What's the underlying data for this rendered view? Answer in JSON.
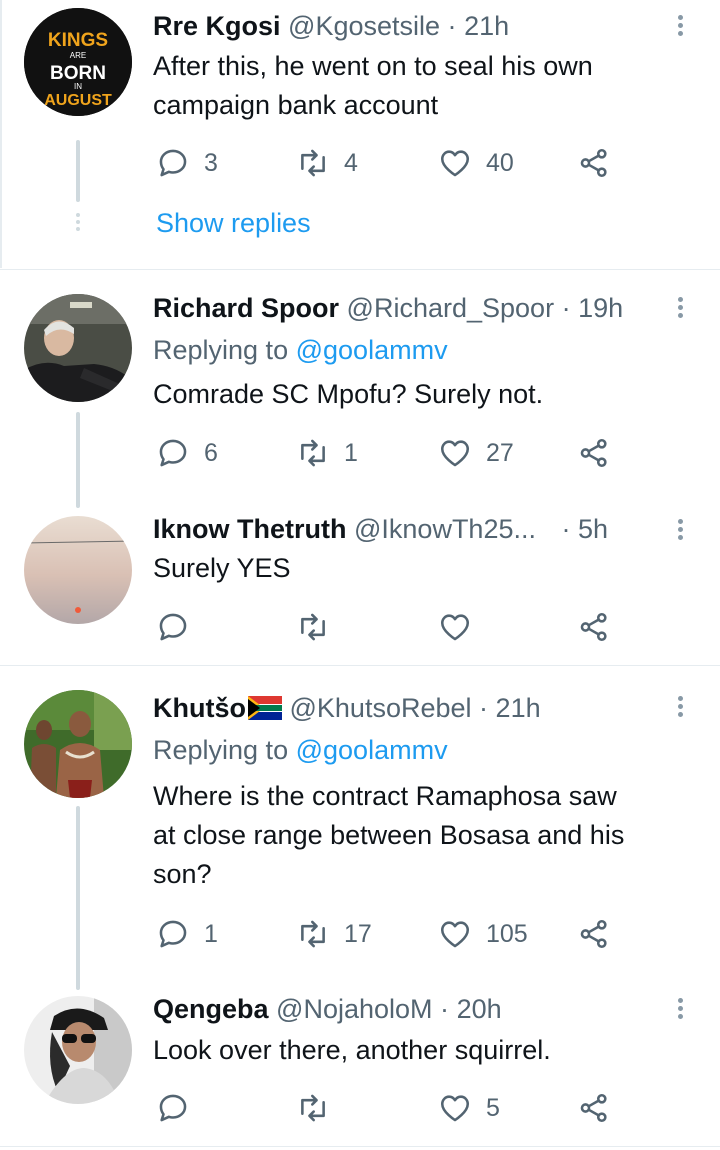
{
  "tweets": [
    {
      "name": "Rre Kgosi",
      "handle": "@Kgosetsile",
      "time": "21h",
      "text_lines": [
        "After this, he went on to seal his own",
        "campaign bank account"
      ],
      "replies": "3",
      "retweets": "4",
      "likes": "40",
      "avatar_text": {
        "line1": "KINGS",
        "line2": "ARE",
        "line3": "BORN",
        "line4": "IN",
        "line5": "AUGUST"
      }
    },
    {
      "name": "Richard Spoor",
      "handle": "@Richard_Spoor",
      "time": "19h",
      "replying_prefix": "Replying to",
      "replying_to": "@goolammv",
      "text_lines": [
        "Comrade SC Mpofu? Surely not."
      ],
      "replies": "6",
      "retweets": "1",
      "likes": "27"
    },
    {
      "name": "Iknow Thetruth",
      "handle": "@IknowTh25...",
      "time": "5h",
      "text_lines": [
        "Surely YES"
      ],
      "replies": "",
      "retweets": "",
      "likes": ""
    },
    {
      "name": "Khutšo",
      "handle": "@KhutsoRebel",
      "time": "21h",
      "replying_prefix": "Replying to",
      "replying_to": "@goolammv",
      "text_lines": [
        "Where is the contract Ramaphosa saw",
        "at close range between Bosasa and his",
        "son?"
      ],
      "replies": "1",
      "retweets": "17",
      "likes": "105"
    },
    {
      "name": "Qengeba",
      "handle": "@NojaholoM",
      "time": "20h",
      "text_lines": [
        "Look over there, another squirrel."
      ],
      "replies": "",
      "retweets": "",
      "likes": "5"
    }
  ],
  "show_replies_label": "Show replies",
  "separator": "·",
  "colors": {
    "accent": "#1d9bf0",
    "muted": "#536471",
    "line": "#cfd9de"
  }
}
